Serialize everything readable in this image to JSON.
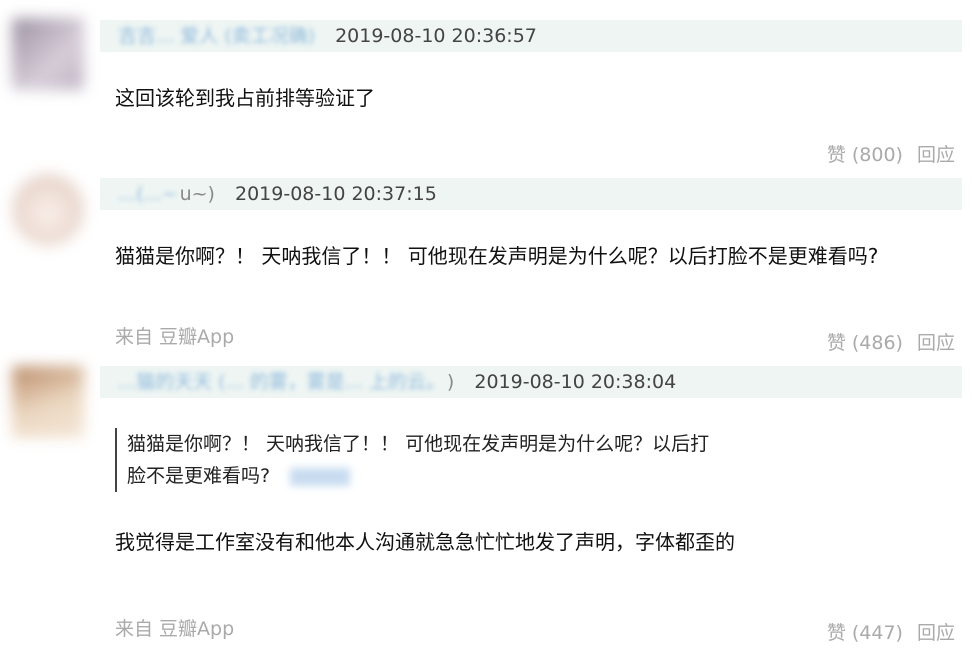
{
  "comments": [
    {
      "username": "吉吉... 爱人 (卖工况确)",
      "timestamp": "2019-08-10 20:36:57",
      "text": "这回该轮到我占前排等验证了",
      "source": "",
      "like_label": "赞 (800)",
      "reply_label": "回应",
      "avatar_color": "#b0a8b8"
    },
    {
      "username": "...(...~",
      "username_tail": "u~)",
      "timestamp": "2019-08-10 20:37:15",
      "text": "猫猫是你啊？！ 天呐我信了！！ 可他现在发声明是为什么呢？以后打脸不是更难看吗?",
      "source": "来自 豆瓣App",
      "like_label": "赞 (486)",
      "reply_label": "回应",
      "avatar_color": "#efe2dc"
    },
    {
      "username": "...猫的天天 (... 的雾，雾是... 上的云。",
      "username_tail": ")",
      "timestamp": "2019-08-10 20:38:04",
      "quote_line1": "猫猫是你啊？！ 天呐我信了！！ 可他现在发声明是为什么呢？以后打",
      "quote_line2": "脸不是更难看吗?",
      "text": "我觉得是工作室没有和他本人沟通就急急忙忙地发了声明，字体都歪的",
      "source": "来自 豆瓣App",
      "like_label": "赞 (447)",
      "reply_label": "回应",
      "avatar_color": "#d8b89c"
    }
  ]
}
